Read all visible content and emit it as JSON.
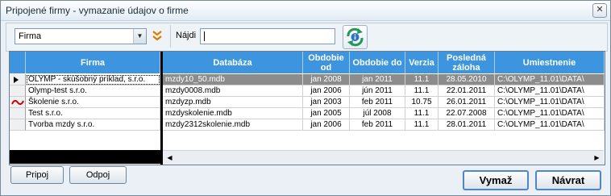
{
  "window": {
    "title": "Pripojené firmy - vymazanie údajov o firme",
    "close_glyph": "✕"
  },
  "toolbar": {
    "combo_value": "Firma",
    "find_label": "Nájdi",
    "find_value": ""
  },
  "table": {
    "columns": [
      "Firma",
      "Databáza",
      "Obdobie od",
      "Obdobie do",
      "Verzia",
      "Posledná záloha",
      "Umiestnenie"
    ],
    "rows": [
      {
        "firma": "OLYMP - skúšobný príklad, s.r.o.",
        "db": "mzdy10_50.mdb",
        "od": "jan 2008",
        "do": "jan 2011",
        "verzia": "11.1",
        "zaloha": "28.05.2010",
        "umiestnenie": "C:\\OLYMP_11.01\\DATA\\",
        "indicator": "arrow"
      },
      {
        "firma": "Olymp-test s.r.o.",
        "db": "mzdy0008.mdb",
        "od": "jan 2006",
        "do": "jún 2011",
        "verzia": "11.1",
        "zaloha": "22.01.2011",
        "umiestnenie": "C:\\OLYMP_11.01\\DATA\\",
        "indicator": ""
      },
      {
        "firma": "Školenie s.r.o.",
        "db": "mzdyzp.mdb",
        "od": "jan 2003",
        "do": "feb 2011",
        "verzia": "10.75",
        "zaloha": "26.01.2011",
        "umiestnenie": "C:\\OLYMP_11.01\\DATA\\",
        "indicator": "warning"
      },
      {
        "firma": "Test s.r.o.",
        "db": "mzdyskolenie.mdb",
        "od": "jan 2005",
        "do": "júl 2008",
        "verzia": "11.1",
        "zaloha": "22.07.2008",
        "umiestnenie": "C:\\OLYMP_11.01\\DATA\\",
        "indicator": ""
      },
      {
        "firma": "Tvorba mzdy s.r.o.",
        "db": "mzdy2312skolenie.mdb",
        "od": "jan 2006",
        "do": "feb 2011",
        "verzia": "11.1",
        "zaloha": "28.01.2011",
        "umiestnenie": "C:\\OLYMP_11.01\\DATA\\",
        "indicator": ""
      }
    ]
  },
  "buttons": {
    "pripoj": "Pripoj",
    "odpoj": "Odpoj",
    "vymaz": "Vymaž",
    "navrat": "Návrat"
  },
  "colors": {
    "header": "#3c95de",
    "selected_row": "#8c8c8c",
    "warning": "#d40000"
  }
}
